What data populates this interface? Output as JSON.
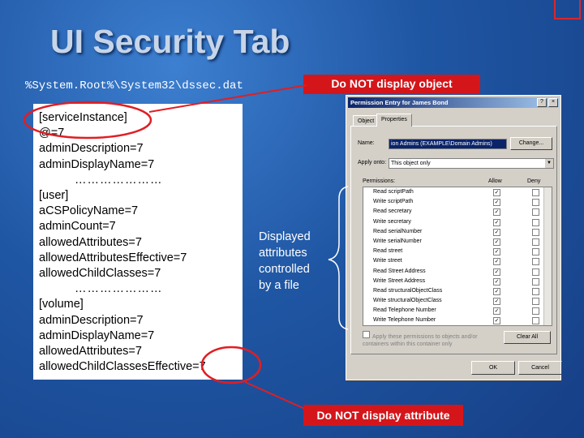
{
  "slide": {
    "title": "UI Security Tab",
    "path": "%System.Root%\\System32\\dssec.dat",
    "label_object": "Do NOT display object",
    "label_attribute": "Do NOT display attribute",
    "file_lines": [
      "[serviceInstance]",
      "@=7",
      "adminDescription=7",
      "adminDisplayName=7",
      "…………………",
      "[user]",
      "aCSPolicyName=7",
      "adminCount=7",
      "allowedAttributes=7",
      "allowedAttributesEffective=7",
      "allowedChildClasses=7",
      "…………………",
      "[volume]",
      "adminDescription=7",
      "adminDisplayName=7",
      "allowedAttributes=7",
      "allowedChildClassesEffective=7"
    ],
    "description_lines": [
      "Displayed",
      "attributes",
      "controlled",
      "by a file"
    ],
    "colors": {
      "background": "#1f56a3",
      "callout": "#d4161b",
      "title": "#c7d5e8"
    }
  },
  "dialog": {
    "title": "Permission Entry for James Bond",
    "title_buttons": [
      "?",
      "×"
    ],
    "tabs": [
      "Object",
      "Properties"
    ],
    "name_label": "Name:",
    "name_value": "ion Admins (EXAMPLE\\Domain Admins)",
    "change_button": "Change...",
    "apply_label": "Apply onto:",
    "apply_value": "This object only",
    "permissions_header": "Permissions:",
    "allow_header": "Allow",
    "deny_header": "Deny",
    "permissions": [
      {
        "name": "Read scriptPath",
        "allow": true,
        "deny": false
      },
      {
        "name": "Write scriptPath",
        "allow": true,
        "deny": false
      },
      {
        "name": "Read secretary",
        "allow": true,
        "deny": false
      },
      {
        "name": "Write secretary",
        "allow": true,
        "deny": false
      },
      {
        "name": "Read serialNumber",
        "allow": true,
        "deny": false
      },
      {
        "name": "Write serialNumber",
        "allow": true,
        "deny": false
      },
      {
        "name": "Read street",
        "allow": true,
        "deny": false
      },
      {
        "name": "Write street",
        "allow": true,
        "deny": false
      },
      {
        "name": "Read Street Address",
        "allow": true,
        "deny": false
      },
      {
        "name": "Write Street Address",
        "allow": true,
        "deny": false
      },
      {
        "name": "Read structuralObjectClass",
        "allow": true,
        "deny": false
      },
      {
        "name": "Write structuralObjectClass",
        "allow": true,
        "deny": false
      },
      {
        "name": "Read Telephone Number",
        "allow": true,
        "deny": false
      },
      {
        "name": "Write Telephone Number",
        "allow": true,
        "deny": false
      }
    ],
    "apply_check_label": "Apply these permissions to objects and/or containers within this container only",
    "clear_all_button": "Clear All",
    "ok_button": "OK",
    "cancel_button": "Cancel"
  }
}
